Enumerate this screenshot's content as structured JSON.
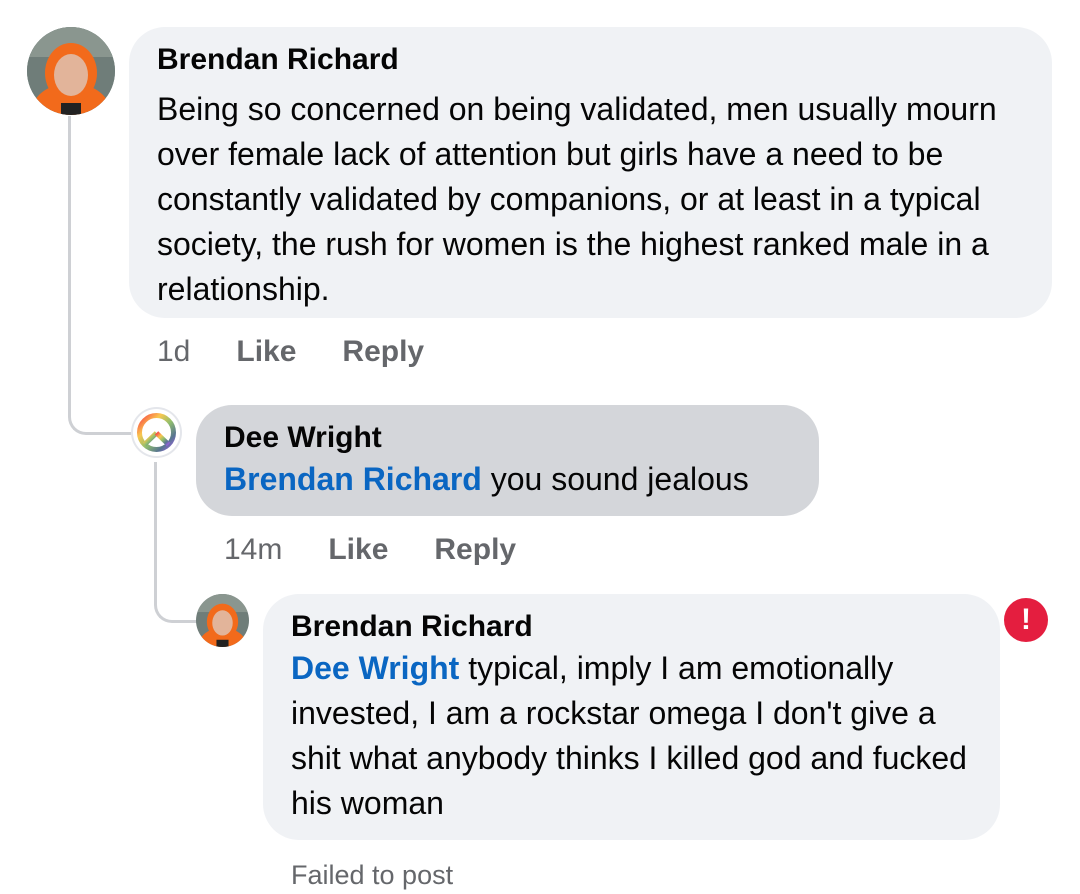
{
  "comments": [
    {
      "author": "Brendan Richard",
      "text": "Being so concerned on being validated, men usually mourn over female lack of attention but girls have a need to be constantly validated by companions, or at least in a typical society, the rush for women is the highest ranked male in a relationship.",
      "time": "1d",
      "like_label": "Like",
      "reply_label": "Reply"
    },
    {
      "author": "Dee Wright",
      "mention": "Brendan Richard",
      "text": " you sound jealous",
      "time": "14m",
      "like_label": "Like",
      "reply_label": "Reply"
    },
    {
      "author": "Brendan Richard",
      "mention": "Dee Wright",
      "text": " typical, imply I am emotionally invested, I am a rockstar omega I don't give a shit what anybody thinks I killed god and fucked his woman",
      "status": "Failed to post",
      "error_glyph": "!"
    }
  ],
  "colors": {
    "bubble": "#f0f2f5",
    "bubble_selected": "#d4d6da",
    "mention": "#0a66c2",
    "error": "#e41e3f",
    "meta": "#65676b"
  }
}
